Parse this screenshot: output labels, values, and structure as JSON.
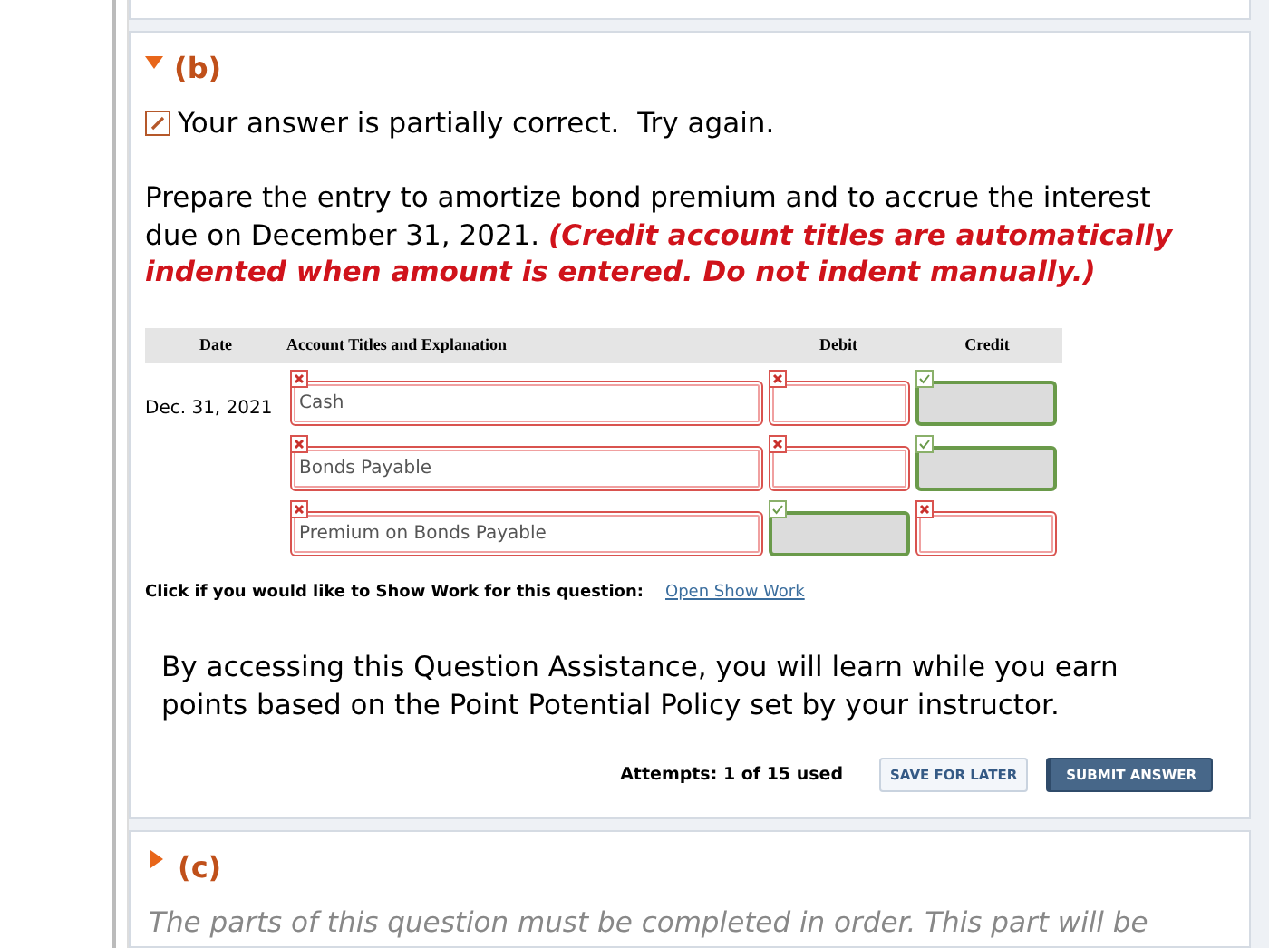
{
  "part_b": {
    "label": "(b)",
    "expanded": true,
    "feedback": "Your answer is partially correct.  Try again.",
    "prompt": "Prepare the entry to amortize bond premium and to accrue the interest due on December 31, 2021. **(Credit account titles are automatically indented when amount is entered. Do not indent manually.)**",
    "table": {
      "columns": [
        "Date",
        "Account Titles and Explanation",
        "Debit",
        "Credit"
      ],
      "rows": [
        {
          "date": "Dec. 31, 2021",
          "account": {
            "value": "Cash",
            "correct": false
          },
          "debit": {
            "correct": false
          },
          "credit": {
            "correct": true
          }
        },
        {
          "account": {
            "value": "Bonds Payable",
            "correct": false
          },
          "debit": {
            "correct": false
          },
          "credit": {
            "correct": true
          }
        },
        {
          "account": {
            "value": "Premium on Bonds Payable",
            "correct": false
          },
          "debit": {
            "correct": true
          },
          "credit": {
            "correct": false
          }
        }
      ]
    },
    "show_work_label": "Click if you would like to Show Work for this question:",
    "show_work_link": "Open Show Work",
    "assistance": "By accessing this Question Assistance, you will learn while you earn points based on the Point Potential Policy set by your instructor.",
    "attempts": "Attempts: 1 of 15 used",
    "buttons": [
      "SAVE FOR LATER",
      "SUBMIT ANSWER"
    ]
  },
  "part_c": {
    "label": "(c)",
    "expanded": false,
    "note": "The parts of this question must be completed in order. This part will be"
  }
}
